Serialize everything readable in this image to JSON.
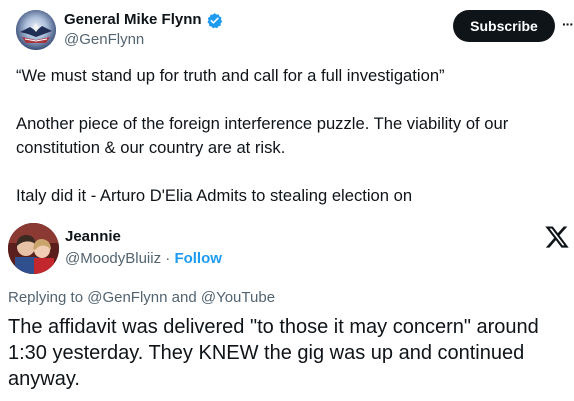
{
  "post": {
    "author_name": "General Mike Flynn",
    "author_handle": "@GenFlynn",
    "subscribe_label": "Subscribe",
    "more_label": "···",
    "paragraphs": [
      "“We must stand up for truth and call for a full investigation”",
      "Another piece of the foreign interference puzzle. The viability of our constitution & our country are at risk.",
      "Italy did it -  Arturo D'Elia  Admits to stealing election on"
    ]
  },
  "embed": {
    "author_name": "Jeannie",
    "author_handle": "@MoodyBluiiz",
    "separator": "·",
    "follow_label": "Follow",
    "reply_prefix": "Replying to",
    "reply_mention_1": "@GenFlynn",
    "reply_and": "and",
    "reply_mention_2": "@YouTube",
    "text": "The affidavit was delivered \"to those it may concern\" around 1:30 yesterday.  They KNEW the gig was up and continued anyway."
  },
  "icons": {
    "verified": "verified-badge-icon",
    "x_logo": "x-logo-icon",
    "more": "more-horizontal-icon"
  },
  "colors": {
    "verified": "#1d9bf0",
    "link": "#1d9bf0",
    "muted": "#536471",
    "button_bg": "#0f1419"
  }
}
